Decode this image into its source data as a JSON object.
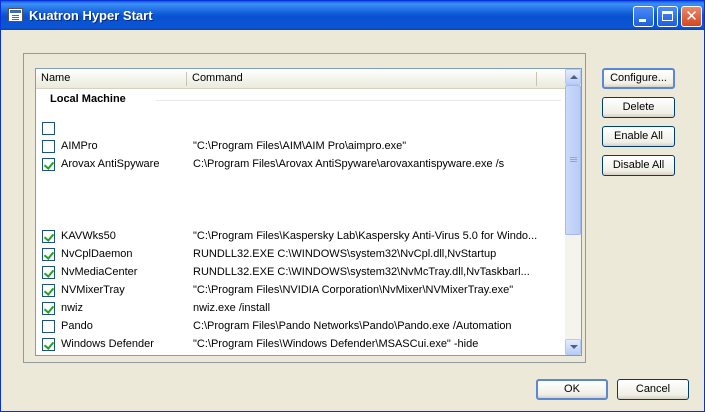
{
  "window": {
    "title": "Kuatron Hyper Start"
  },
  "list": {
    "columns": [
      "Name",
      "Command"
    ],
    "group_label": "Local Machine",
    "rows": [
      {
        "name": "",
        "command": "",
        "checked": false
      },
      {
        "name": "AIMPro",
        "command": "\"C:\\Program Files\\AIM\\AIM Pro\\aimpro.exe\"",
        "checked": false
      },
      {
        "name": "Arovax AntiSpyware",
        "command": "C:\\Program Files\\Arovax AntiSpyware\\arovaxantispyware.exe /s",
        "checked": true
      },
      {
        "name": "KAVWks50",
        "command": "\"C:\\Program Files\\Kaspersky Lab\\Kaspersky Anti-Virus 5.0 for Windo...",
        "checked": true
      },
      {
        "name": "NvCplDaemon",
        "command": "RUNDLL32.EXE C:\\WINDOWS\\system32\\NvCpl.dll,NvStartup",
        "checked": true
      },
      {
        "name": "NvMediaCenter",
        "command": "RUNDLL32.EXE C:\\WINDOWS\\system32\\NvMcTray.dll,NvTaskbarl...",
        "checked": true
      },
      {
        "name": "NVMixerTray",
        "command": "\"C:\\Program Files\\NVIDIA Corporation\\NvMixer\\NVMixerTray.exe\"",
        "checked": true
      },
      {
        "name": "nwiz",
        "command": "nwiz.exe /install",
        "checked": true
      },
      {
        "name": "Pando",
        "command": "C:\\Program Files\\Pando Networks\\Pando\\Pando.exe /Automation",
        "checked": false
      },
      {
        "name": "Windows Defender",
        "command": "\"C:\\Program Files\\Windows Defender\\MSASCui.exe\" -hide",
        "checked": true
      }
    ]
  },
  "side_buttons": {
    "configure": "Configure...",
    "delete": "Delete",
    "enable_all": "Enable All",
    "disable_all": "Disable All"
  },
  "footer": {
    "ok": "OK",
    "cancel": "Cancel"
  },
  "titlebar_buttons": {
    "close_glyph": "✕"
  },
  "colors": {
    "titlebar": "#0a5fd8",
    "dialog_bg": "#ece9d8",
    "check": "#21a121"
  }
}
